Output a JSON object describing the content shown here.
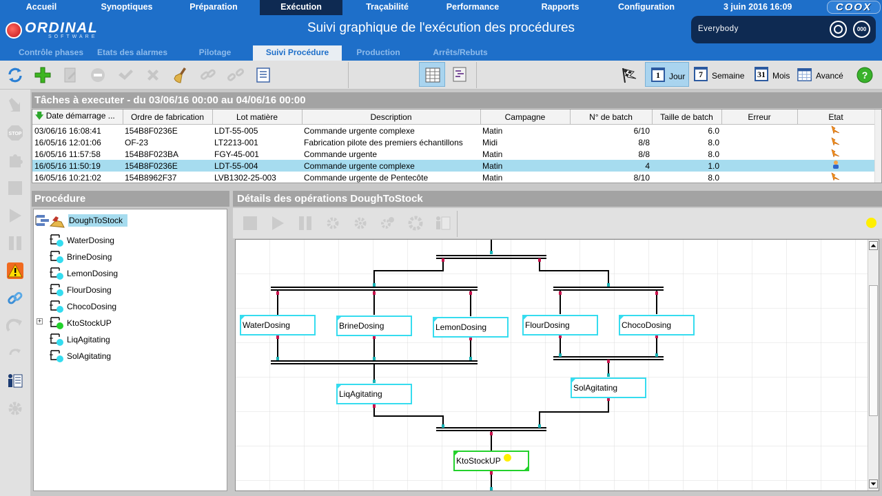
{
  "nav": {
    "items": [
      "Accueil",
      "Synoptiques",
      "Préparation",
      "Exécution",
      "Traçabilité",
      "Performance",
      "Rapports",
      "Configuration"
    ],
    "active": "Exécution",
    "datetime": "3 juin 2016 16:09",
    "brand_right": "COOX"
  },
  "header": {
    "logo_text": "ORDINAL",
    "logo_sub": "SOFTWARE",
    "title": "Suivi graphique de l'exécution des procédures",
    "user": "Everybody",
    "round_button_label": "000"
  },
  "subtabs": {
    "items": [
      "Contrôle phases",
      "Etats des alarmes",
      "Pilotage",
      "Suivi Procédure",
      "Production",
      "Arrêts/Rebuts"
    ],
    "active": "Suivi Procédure"
  },
  "toolbar": {
    "views": [
      {
        "icon": "1",
        "label": "Jour",
        "active": true
      },
      {
        "icon": "7",
        "label": "Semaine",
        "active": false
      },
      {
        "icon": "31",
        "label": "Mois",
        "active": false
      },
      {
        "icon": "",
        "label": "Avancé",
        "active": false
      }
    ]
  },
  "tasks": {
    "title": "Tâches à executer -  du 03/06/16 00:00 au 04/06/16 00:00",
    "columns": [
      "Date démarrage ...",
      "Ordre de fabrication",
      "Lot matière",
      "Description",
      "Campagne",
      "N° de batch",
      "Taille de batch",
      "Erreur",
      "Etat"
    ],
    "rows": [
      {
        "date": "03/06/16 16:08:41",
        "of": "154B8F0236E",
        "lot": "LDT-55-005",
        "desc": "Commande urgente complexe",
        "campagne": "Matin",
        "batch": "6/10",
        "taille": "6.0",
        "erreur": "",
        "etat": "running",
        "selected": false
      },
      {
        "date": "16/05/16 12:01:06",
        "of": "OF-23",
        "lot": "LT2213-001",
        "desc": "Fabrication pilote des premiers échantillons",
        "campagne": "Midi",
        "batch": "8/8",
        "taille": "8.0",
        "erreur": "",
        "etat": "running",
        "selected": false
      },
      {
        "date": "16/05/16 11:57:58",
        "of": "154B8F023BA",
        "lot": "FGY-45-001",
        "desc": "Commande urgente",
        "campagne": "Matin",
        "batch": "8/8",
        "taille": "8.0",
        "erreur": "",
        "etat": "running",
        "selected": false
      },
      {
        "date": "16/05/16 11:50:19",
        "of": "154B8F0236E",
        "lot": "LDT-55-004",
        "desc": "Commande urgente complexe",
        "campagne": "Matin",
        "batch": "4",
        "taille": "1.0",
        "erreur": "",
        "etat": "user",
        "selected": true
      },
      {
        "date": "16/05/16 10:21:02",
        "of": "154B8962F37",
        "lot": "LVB1302-25-003",
        "desc": "Commande urgente de Pentecôte",
        "campagne": "Matin",
        "batch": "8/10",
        "taille": "8.0",
        "erreur": "",
        "etat": "running",
        "selected": false
      }
    ]
  },
  "procedure": {
    "title": "Procédure",
    "root": "DoughToStock",
    "items": [
      {
        "label": "WaterDosing",
        "status": "cyan"
      },
      {
        "label": "BrineDosing",
        "status": "cyan"
      },
      {
        "label": "LemonDosing",
        "status": "cyan"
      },
      {
        "label": "FlourDosing",
        "status": "cyan"
      },
      {
        "label": "ChocoDosing",
        "status": "cyan"
      },
      {
        "label": "KtoStockUP",
        "status": "green",
        "expandable": true
      },
      {
        "label": "LiqAgitating",
        "status": "cyan"
      },
      {
        "label": "SolAgitating",
        "status": "cyan"
      }
    ]
  },
  "details": {
    "title": "Détails des opérations DoughToStock",
    "ops": {
      "water": "WaterDosing",
      "brine": "BrineDosing",
      "lemon": "LemonDosing",
      "flour": "FlourDosing",
      "choco": "ChocoDosing",
      "liq": "LiqAgitating",
      "sol": "SolAgitating",
      "kto": "KtoStockUP"
    }
  },
  "colors": {
    "nav_blue": "#1e6fc9",
    "nav_dark": "#0e2a52",
    "cyan_op": "#35dcef",
    "green_op": "#22d12b",
    "selected_row": "#a6dcef"
  }
}
